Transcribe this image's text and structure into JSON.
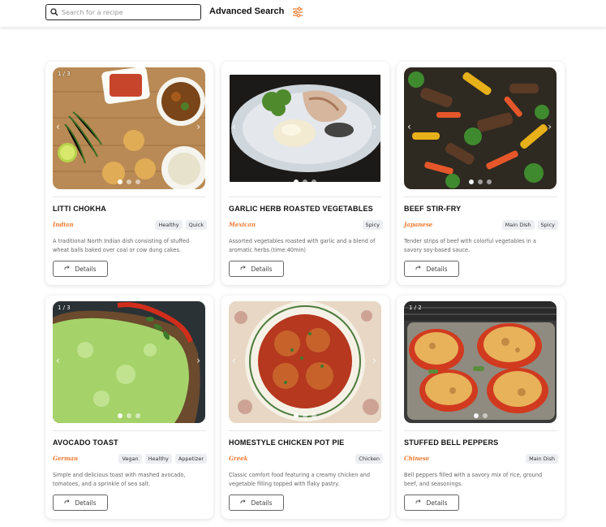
{
  "header": {
    "search_placeholder": "Search for a recipe",
    "advanced_search_label": "Advanced Search"
  },
  "colors": {
    "cuisine": "#ef7a2f",
    "tag_bg": "#eceef2",
    "accent_icon": "#ef7a2f"
  },
  "recipes": [
    {
      "counter": "1 / 3",
      "title": "LITTI CHOKHA",
      "cuisine": "Indian",
      "tags": [
        "Healthy",
        "Quick"
      ],
      "description": "A traditional North Indian dish consisting of stuffed wheat balls baked over coal or cow dung cakes.",
      "details_label": "Details",
      "image_icon": "litti-chokha-photo"
    },
    {
      "counter": "",
      "title": "GARLIC HERB ROASTED VEGETABLES",
      "cuisine": "Mexican",
      "tags": [
        "Spicy"
      ],
      "description": "Assorted vegetables roasted with garlic and a blend of aromatic herbs.(time:40min)",
      "details_label": "Details",
      "image_icon": "roasted-vegetables-photo"
    },
    {
      "counter": "",
      "title": "BEEF STIR-FRY",
      "cuisine": "Japanese",
      "tags": [
        "Main Dish",
        "Spicy"
      ],
      "description": "Tender strips of beef with colorful vegetables in a savory soy-based sauce.",
      "details_label": "Details",
      "image_icon": "beef-stir-fry-photo"
    },
    {
      "counter": "1 / 3",
      "title": "AVOCADO TOAST",
      "cuisine": "German",
      "tags": [
        "Vegan",
        "Healthy",
        "Appetizer"
      ],
      "description": "Simple and delicious toast with mashed avocado, tomatoes, and a sprinkle of sea salt.",
      "details_label": "Details",
      "image_icon": "avocado-toast-photo"
    },
    {
      "counter": "",
      "title": "HOMESTYLE CHICKEN POT PIE",
      "cuisine": "Greek",
      "tags": [
        "Chicken"
      ],
      "description": "Classic comfort food featuring a creamy chicken and vegetable filling topped with flaky pastry.",
      "details_label": "Details",
      "image_icon": "chicken-pot-pie-photo"
    },
    {
      "counter": "1 / 2",
      "title": "STUFFED BELL PEPPERS",
      "cuisine": "Chinese",
      "tags": [
        "Main Dish"
      ],
      "description": "Bell peppers filled with a savory mix of rice, ground beef, and seasonings.",
      "details_label": "Details",
      "image_icon": "stuffed-peppers-photo"
    }
  ]
}
